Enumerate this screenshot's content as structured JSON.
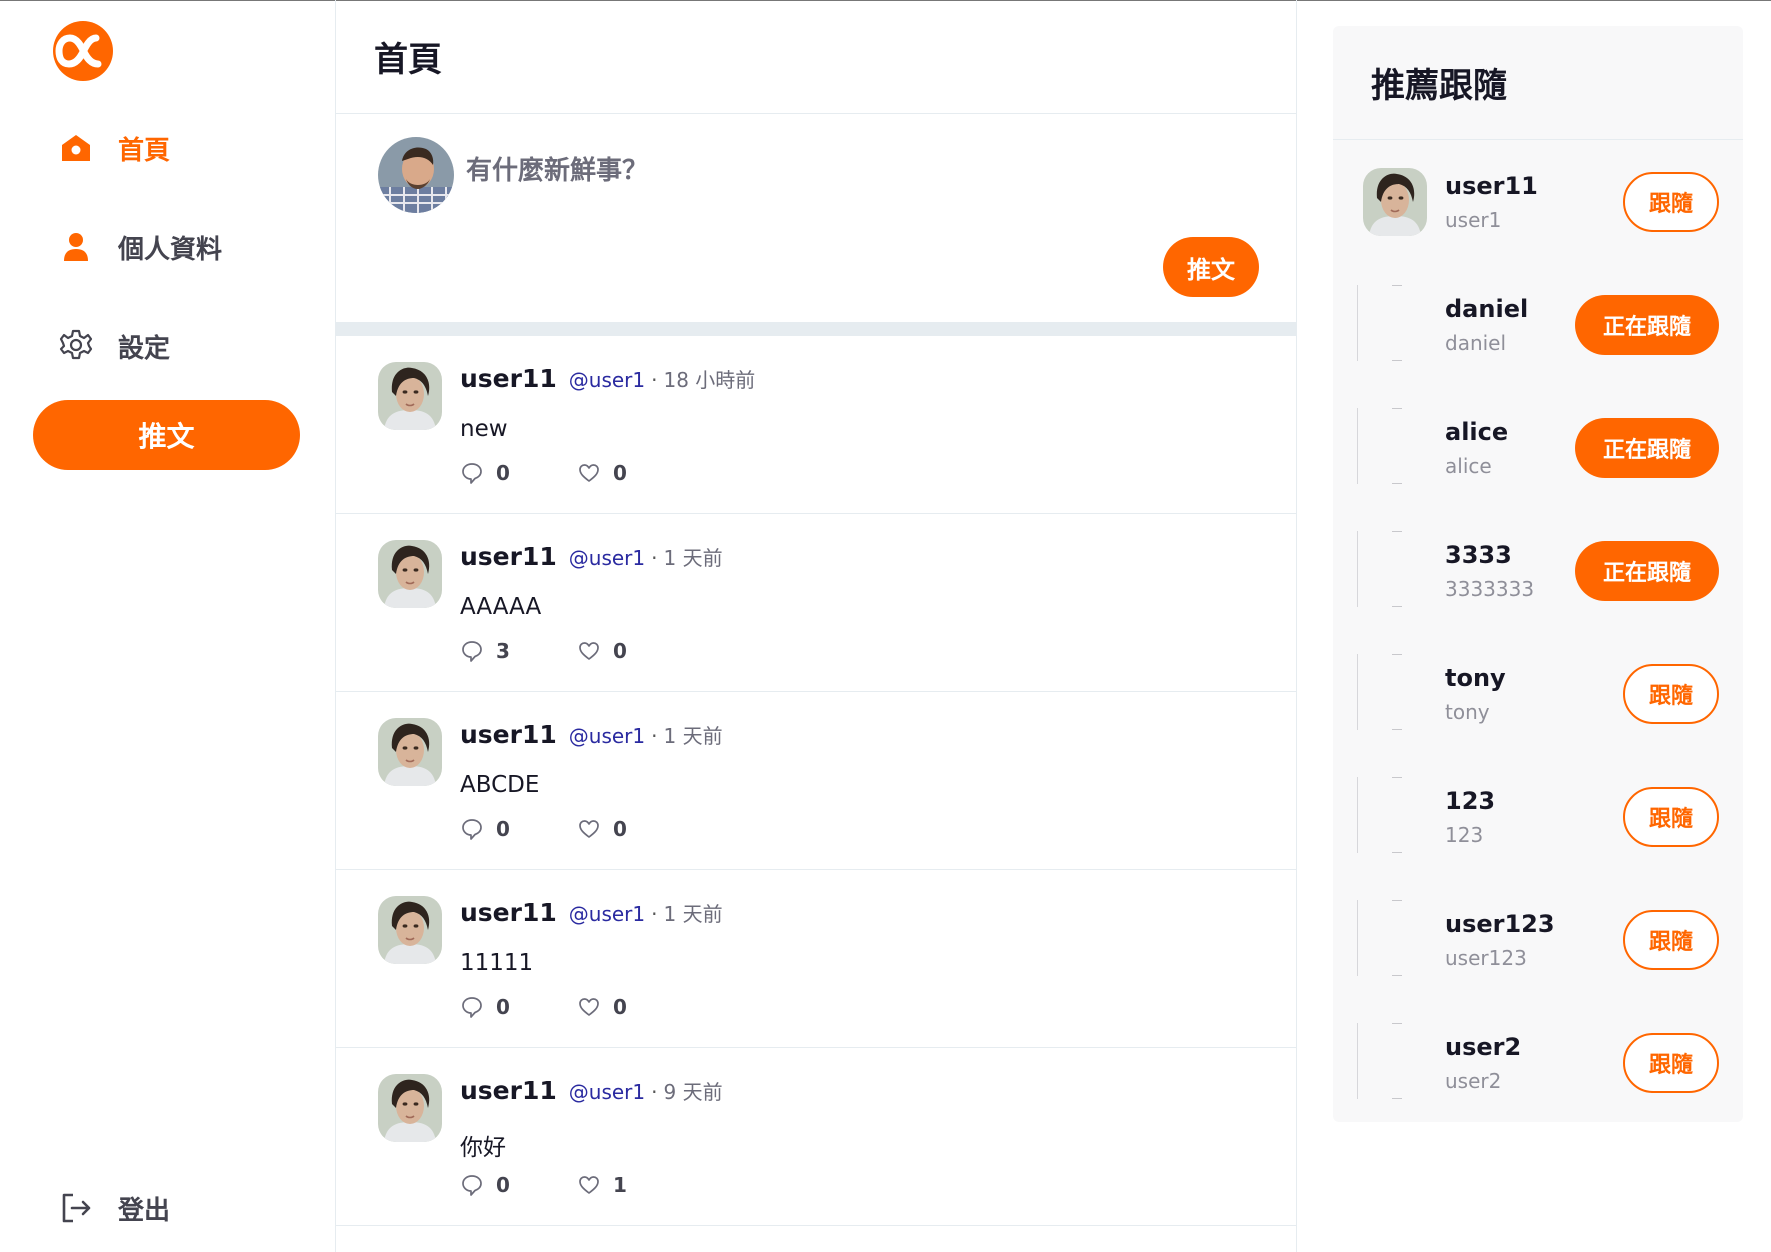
{
  "colors": {
    "accent": "#ff6600",
    "text": "#171725",
    "muted": "#6c6c7a",
    "handle": "#2a2aa0"
  },
  "sidebar": {
    "logo": "alpha-logo-icon",
    "items": [
      {
        "label": "首頁",
        "icon": "home-icon",
        "active": true
      },
      {
        "label": "個人資料",
        "icon": "user-icon",
        "active": false
      },
      {
        "label": "設定",
        "icon": "gear-icon",
        "active": false
      }
    ],
    "tweet_button": "推文",
    "logout": {
      "label": "登出",
      "icon": "logout-icon"
    }
  },
  "main": {
    "title": "首頁",
    "composer": {
      "placeholder": "有什麼新鮮事？",
      "button": "推文"
    },
    "tweets": [
      {
        "name": "user11",
        "handle": "@user1",
        "time": "18 小時前",
        "text": "new",
        "replies": "0",
        "likes": "0"
      },
      {
        "name": "user11",
        "handle": "@user1",
        "time": "1 天前",
        "text": "AAAAA",
        "replies": "3",
        "likes": "0"
      },
      {
        "name": "user11",
        "handle": "@user1",
        "time": "1 天前",
        "text": "ABCDE",
        "replies": "0",
        "likes": "0"
      },
      {
        "name": "user11",
        "handle": "@user1",
        "time": "1 天前",
        "text": "11111",
        "replies": "0",
        "likes": "0"
      },
      {
        "name": "user11",
        "handle": "@user1",
        "time": "9 天前",
        "text": "你好",
        "replies": "0",
        "likes": "1"
      }
    ],
    "dot": "·"
  },
  "right": {
    "title": "推薦跟隨",
    "users": [
      {
        "name": "user11",
        "handle": "user1",
        "button": "跟隨",
        "following": false,
        "has_avatar": true
      },
      {
        "name": "daniel",
        "handle": "daniel",
        "button": "正在跟隨",
        "following": true,
        "has_avatar": false
      },
      {
        "name": "alice",
        "handle": "alice",
        "button": "正在跟隨",
        "following": true,
        "has_avatar": false
      },
      {
        "name": "3333",
        "handle": "3333333",
        "button": "正在跟隨",
        "following": true,
        "has_avatar": false
      },
      {
        "name": "tony",
        "handle": "tony",
        "button": "跟隨",
        "following": false,
        "has_avatar": false
      },
      {
        "name": "123",
        "handle": "123",
        "button": "跟隨",
        "following": false,
        "has_avatar": false
      },
      {
        "name": "user123",
        "handle": "user123",
        "button": "跟隨",
        "following": false,
        "has_avatar": false
      },
      {
        "name": "user2",
        "handle": "user2",
        "button": "跟隨",
        "following": false,
        "has_avatar": false
      }
    ]
  }
}
